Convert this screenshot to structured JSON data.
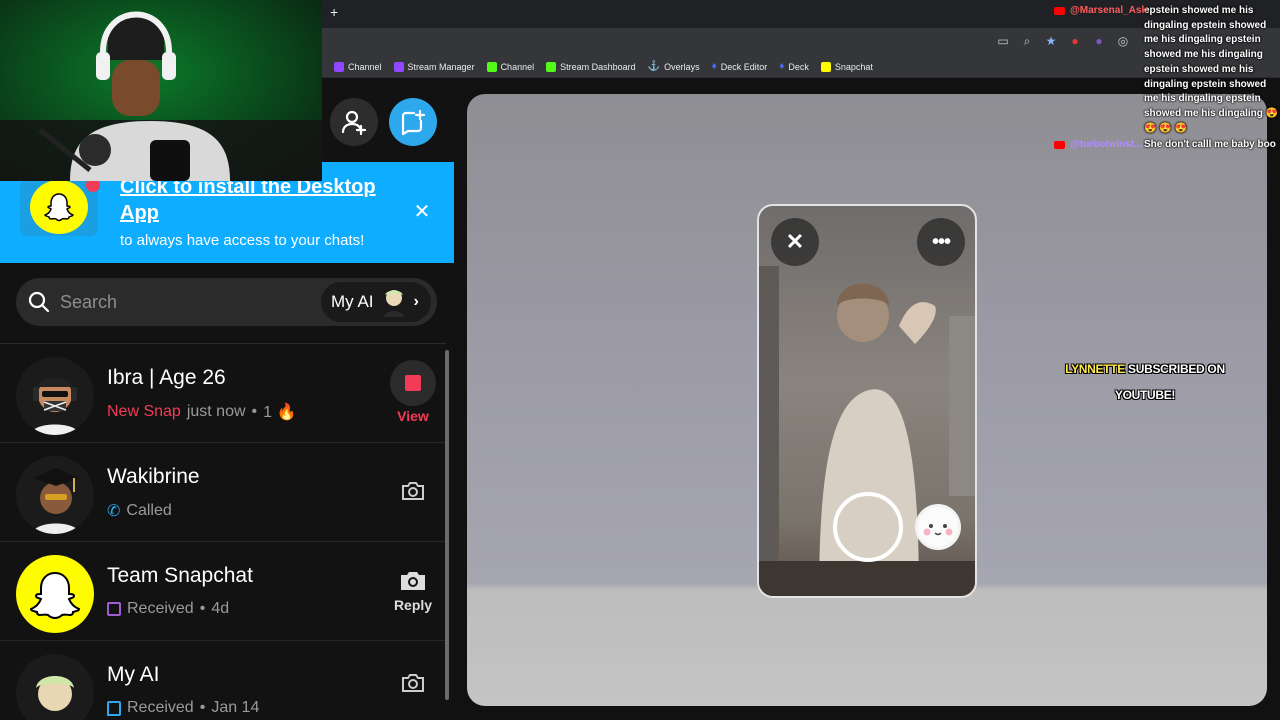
{
  "browser": {
    "newtab_label": "+",
    "bookmarks": [
      {
        "label": "Channel",
        "color": "#9146ff"
      },
      {
        "label": "Stream Manager",
        "color": "#9146ff"
      },
      {
        "label": "Channel",
        "color": "#53fc18"
      },
      {
        "label": "Stream Dashboard",
        "color": "#53fc18"
      },
      {
        "label": "Overlays",
        "color": "#e8eaed"
      },
      {
        "label": "Deck Editor",
        "color": "#4a6cf7"
      },
      {
        "label": "Deck",
        "color": "#4a6cf7"
      },
      {
        "label": "Snapchat",
        "color": "#fffc00"
      }
    ]
  },
  "banner": {
    "title": "Click to install the Desktop App",
    "subtitle": "to always have access to your chats!",
    "close": "✕"
  },
  "search": {
    "placeholder": "Search",
    "my_ai_label": "My AI"
  },
  "chats": [
    {
      "name": "Ibra | Age 26",
      "status": "New Snap",
      "time": "just now",
      "streak": "1 🔥",
      "action": "View"
    },
    {
      "name": "Wakibrine",
      "status": "Called"
    },
    {
      "name": "Team Snapchat",
      "status": "Received",
      "time": "4d",
      "action": "Reply"
    },
    {
      "name": "My AI",
      "status": "Received",
      "time": "Jan 14"
    }
  ],
  "alert": {
    "who": "LYNNETTE",
    "text": "SUBSCRIBED ON YOUTUBE!"
  },
  "overlay_chat": [
    {
      "user": "@Marsenal_Ask",
      "msg": "epstein showed me his dingaling epstein showed me his dingaling epstein showed me his dingaling epstein showed me his dingaling epstein showed me his dingaling epstein showed me his dingaling 😍 😍 😍 😍",
      "color": "#ff5c5c"
    },
    {
      "user": "@turbotwinst...",
      "msg": "She don't calll me baby boo",
      "color": "#b28cff"
    }
  ],
  "colors": {
    "snap_yellow": "#fffc00",
    "new_snap_red": "#f23c57",
    "accent_blue": "#2ea8ec"
  }
}
